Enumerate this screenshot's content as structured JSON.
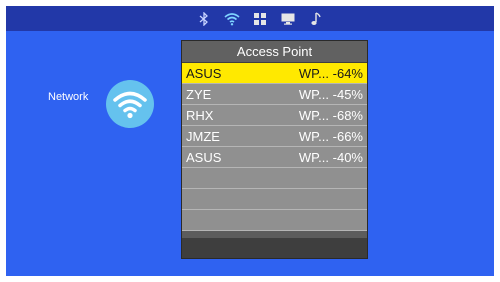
{
  "topbar": {
    "icons": [
      "bluetooth-icon",
      "wifi-icon",
      "apps-icon",
      "display-icon",
      "music-icon"
    ]
  },
  "sidebar": {
    "network_label": "Network",
    "network_icon": "wifi-icon",
    "icon_color": "#65c2ee"
  },
  "panel": {
    "title": "Access Point",
    "items": [
      {
        "name": "ASUS",
        "security": "WP...",
        "signal": "-64%",
        "selected": true
      },
      {
        "name": "ZYE",
        "security": "WP...",
        "signal": "-45%",
        "selected": false
      },
      {
        "name": "RHX",
        "security": "WP...",
        "signal": "-68%",
        "selected": false
      },
      {
        "name": "JMZE",
        "security": "WP...",
        "signal": "-66%",
        "selected": false
      },
      {
        "name": "ASUS",
        "security": "WP...",
        "signal": "-40%",
        "selected": false
      }
    ],
    "empty_rows": 3
  },
  "colors": {
    "background": "#2f62f1",
    "topbar": "#2238a8",
    "selected_row": "#ffe900",
    "row": "#909090"
  }
}
